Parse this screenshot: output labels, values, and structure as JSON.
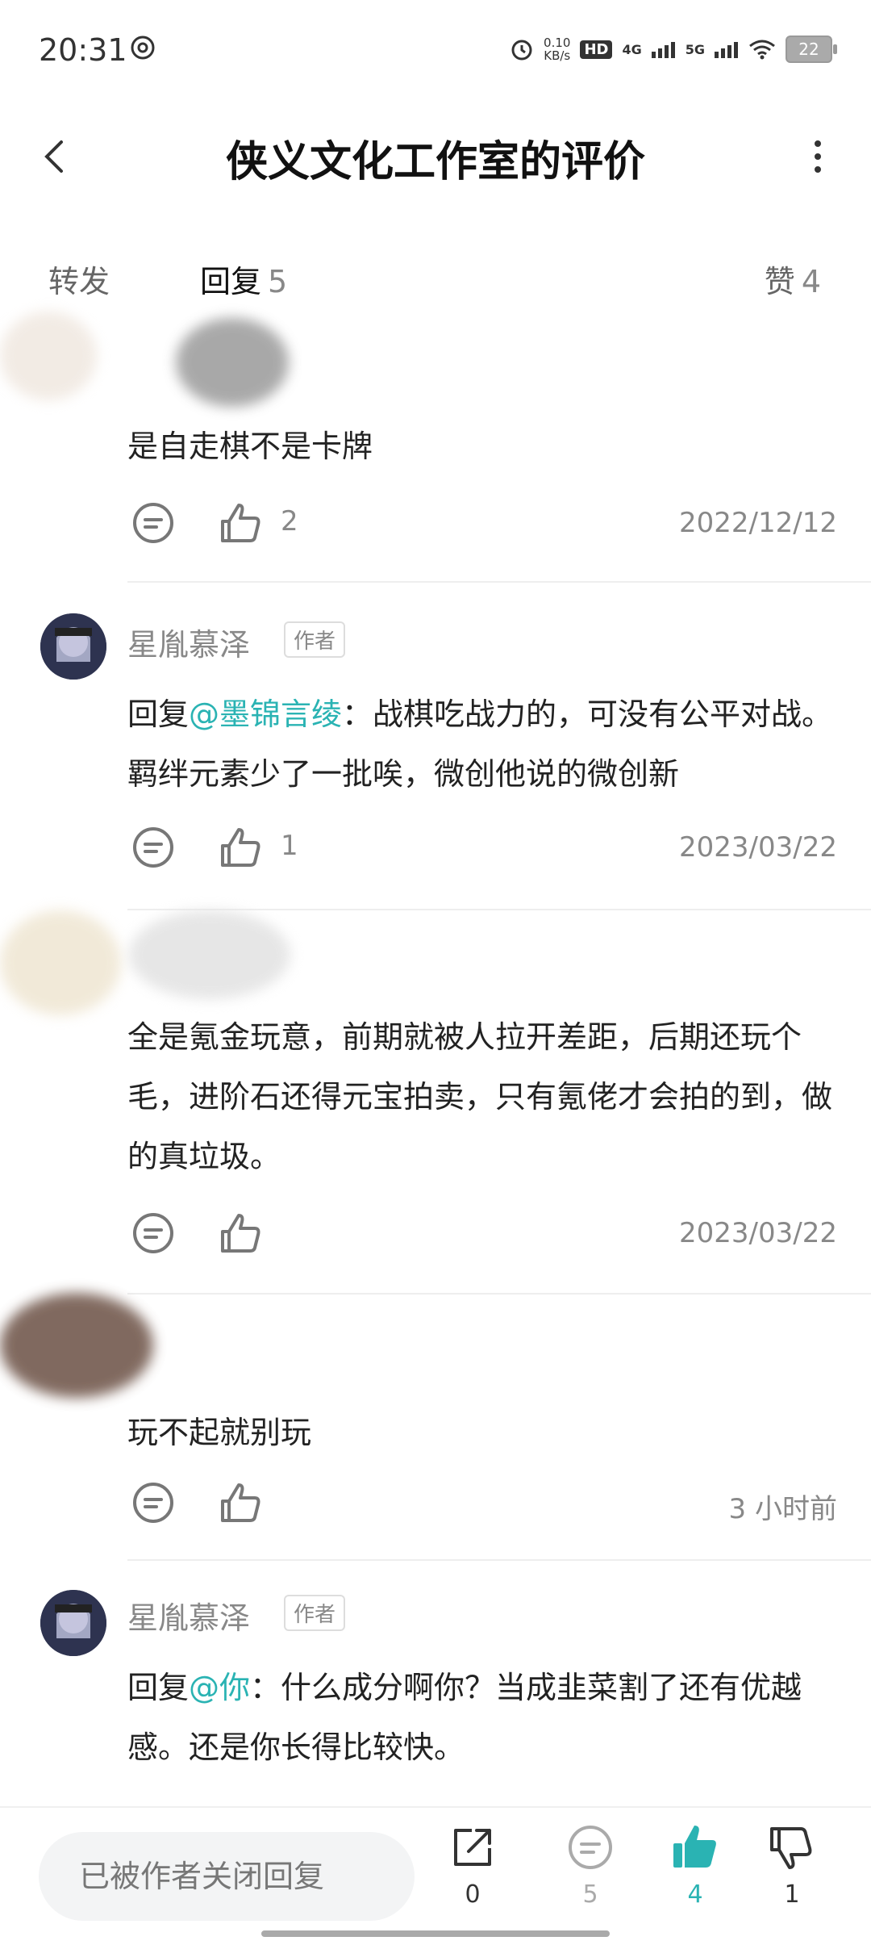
{
  "status": {
    "time": "20:31",
    "net_speed": "0.10\nKB/s",
    "hd": "HD",
    "sig4g": "4G",
    "sig5g": "5G",
    "battery": "22"
  },
  "header": {
    "title": "侠义文化工作室的评价"
  },
  "tabs": {
    "forward": "转发",
    "reply": "回复",
    "reply_count": "5",
    "like": "赞",
    "like_count": "4"
  },
  "comments": [
    {
      "name": "",
      "text": "是自走棋不是卡牌",
      "likes": "2",
      "date": "2022/12/12"
    },
    {
      "name": "星胤慕泽",
      "badge": "作者",
      "prefix": "回复",
      "mention": "@墨锦言绫",
      "text": "：战棋吃战力的，可没有公平对战。羁绊元素少了一批唉，微创他说的微创新",
      "likes": "1",
      "date": "2023/03/22"
    },
    {
      "name": "",
      "text": "全是氪金玩意，前期就被人拉开差距，后期还玩个毛，进阶石还得元宝拍卖，只有氪佬才会拍的到，做的真垃圾。",
      "likes": "",
      "date": "2023/03/22"
    },
    {
      "name": "",
      "text": "玩不起就别玩",
      "likes": "",
      "date": "3 小时前"
    },
    {
      "name": "星胤慕泽",
      "badge": "作者",
      "prefix": "回复",
      "mention": "@你",
      "text": "：什么成分啊你？当成韭菜割了还有优越感。还是你长得比较快。"
    }
  ],
  "bottom": {
    "input_placeholder": "已被作者关闭回复",
    "share_count": "0",
    "reply_count": "5",
    "like_count": "4",
    "dislike_count": "1"
  },
  "colors": {
    "accent": "#2ab3b3"
  },
  "icons": [
    "back-icon",
    "more-icon",
    "reply-icon",
    "like-icon",
    "share-icon",
    "dislike-icon"
  ]
}
